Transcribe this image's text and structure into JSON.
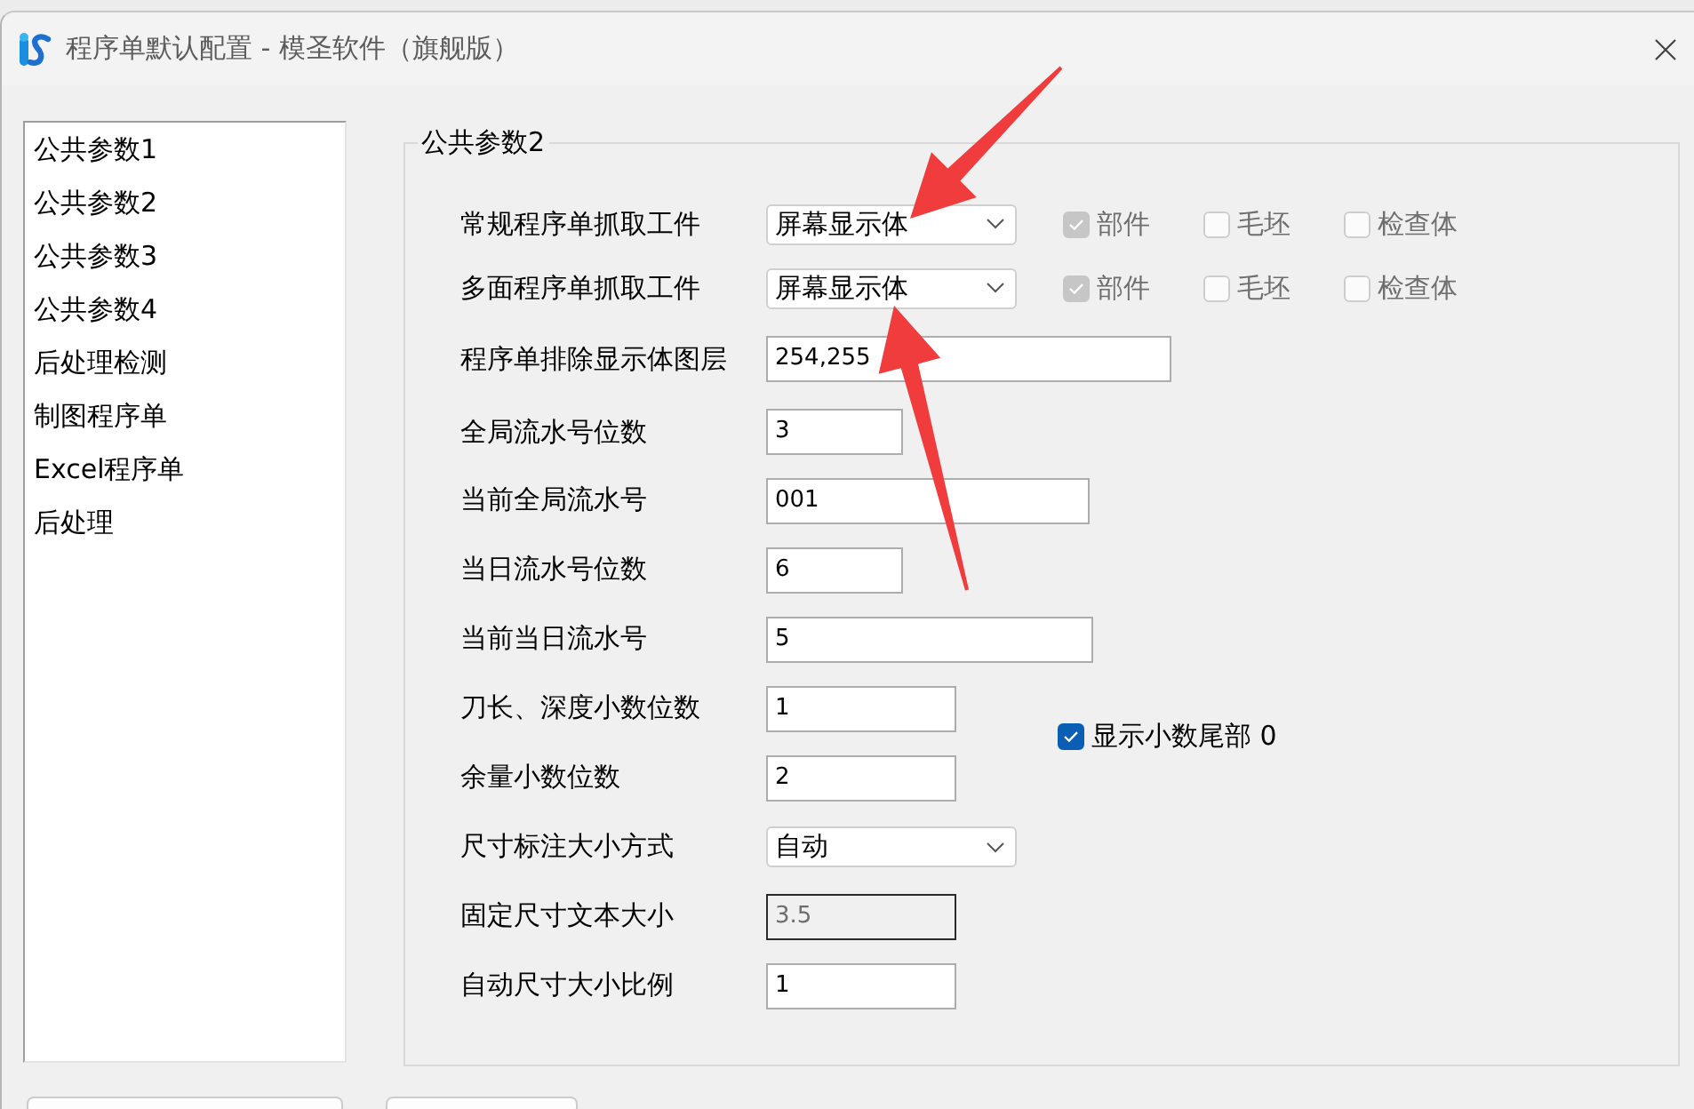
{
  "window": {
    "title": "程序单默认配置 - 模圣软件（旗舰版）"
  },
  "sidebar": {
    "items": [
      {
        "label": "公共参数1"
      },
      {
        "label": "公共参数2"
      },
      {
        "label": "公共参数3"
      },
      {
        "label": "公共参数4"
      },
      {
        "label": "后处理检测"
      },
      {
        "label": "制图程序单"
      },
      {
        "label": "Excel程序单"
      },
      {
        "label": "后处理"
      }
    ]
  },
  "group": {
    "title": "公共参数2",
    "rows": [
      {
        "kind": "select",
        "label": "常规程序单抓取工件",
        "value": "屏幕显示体",
        "disabled": false,
        "options": [
          {
            "label": "部件",
            "checked": true,
            "disabled": true
          },
          {
            "label": "毛坯",
            "checked": false,
            "disabled": true
          },
          {
            "label": "检查体",
            "checked": false,
            "disabled": true
          }
        ]
      },
      {
        "kind": "select",
        "label": "多面程序单抓取工件",
        "value": "屏幕显示体",
        "disabled": false,
        "options": [
          {
            "label": "部件",
            "checked": true,
            "disabled": true
          },
          {
            "label": "毛坯",
            "checked": false,
            "disabled": true
          },
          {
            "label": "检查体",
            "checked": false,
            "disabled": true
          }
        ]
      },
      {
        "kind": "input",
        "label": "程序单排除显示体图层",
        "value": "254,255",
        "disabled": false
      },
      {
        "kind": "input",
        "label": "全局流水号位数",
        "value": "3",
        "disabled": false
      },
      {
        "kind": "input",
        "label": "当前全局流水号",
        "value": "001",
        "disabled": false
      },
      {
        "kind": "input",
        "label": "当日流水号位数",
        "value": "6",
        "disabled": false
      },
      {
        "kind": "input",
        "label": "当前当日流水号",
        "value": "5",
        "disabled": false
      },
      {
        "kind": "input",
        "label": "刀长、深度小数位数",
        "value": "1",
        "disabled": false,
        "side_option": {
          "label": "显示小数尾部 0",
          "checked": true,
          "disabled": false
        }
      },
      {
        "kind": "input",
        "label": "余量小数位数",
        "value": "2",
        "disabled": false
      },
      {
        "kind": "select",
        "label": "尺寸标注大小方式",
        "value": "自动",
        "disabled": false
      },
      {
        "kind": "input",
        "label": "固定尺寸文本大小",
        "value": "3.5",
        "disabled": true
      },
      {
        "kind": "input",
        "label": "自动尺寸大小比例",
        "value": "1",
        "disabled": false
      }
    ]
  }
}
